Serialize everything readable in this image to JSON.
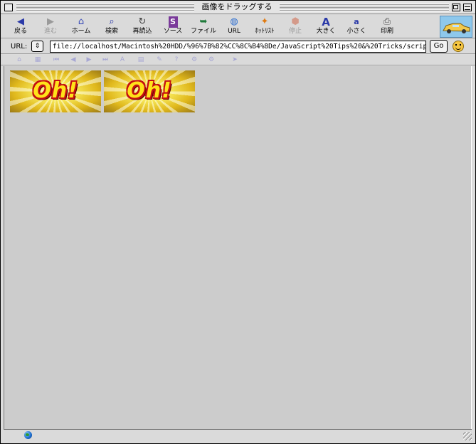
{
  "window": {
    "title": "画像をドラッグする"
  },
  "toolbar": {
    "buttons": [
      {
        "label": "戻る",
        "icon": "back-arrow-icon",
        "enabled": true
      },
      {
        "label": "進む",
        "icon": "forward-arrow-icon",
        "enabled": false
      },
      {
        "label": "ホーム",
        "icon": "home-icon",
        "enabled": true
      },
      {
        "label": "検索",
        "icon": "search-icon",
        "enabled": true
      },
      {
        "label": "再読込",
        "icon": "reload-icon",
        "enabled": true
      },
      {
        "label": "ソース",
        "icon": "source-icon",
        "enabled": true
      },
      {
        "label": "ファイル",
        "icon": "file-icon",
        "enabled": true
      },
      {
        "label": "URL",
        "icon": "globe-icon",
        "enabled": true
      },
      {
        "label": "ﾎｯﾄﾘｽﾄ",
        "icon": "hotlist-icon",
        "enabled": true
      },
      {
        "label": "停止",
        "icon": "stop-icon",
        "enabled": false
      },
      {
        "label": "大きく",
        "icon": "text-larger-icon",
        "enabled": true
      },
      {
        "label": "小さく",
        "icon": "text-smaller-icon",
        "enabled": true
      },
      {
        "label": "印刷",
        "icon": "print-icon",
        "enabled": true
      }
    ]
  },
  "urlbar": {
    "label": "URL:",
    "value": "file://localhost/Macintosh%20HDD/%96%7B%82%CC%8C%B4%8De/JavaScript%20Tips%20&%20Tricks/scrip",
    "go_label": "Go"
  },
  "content": {
    "images": [
      {
        "text": "Oh!"
      },
      {
        "text": "Oh!"
      }
    ]
  }
}
